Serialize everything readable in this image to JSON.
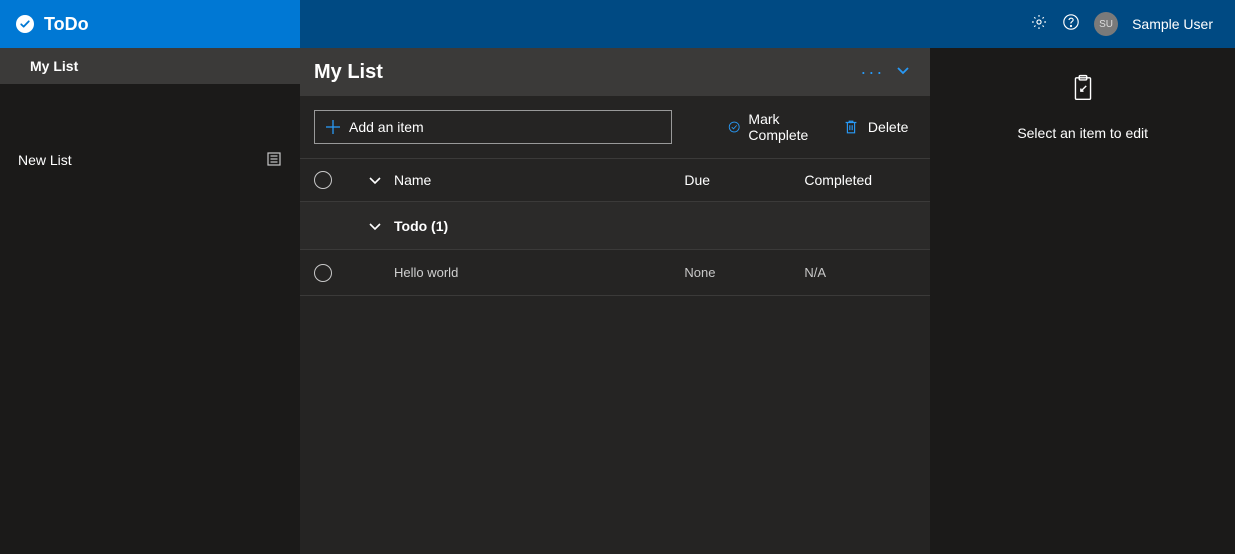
{
  "app": {
    "brand": "ToDo"
  },
  "header": {
    "user_name": "Sample User",
    "user_initials": "SU"
  },
  "sidebar": {
    "lists": [
      {
        "label": "My List",
        "active": true
      }
    ],
    "new_list_label": "New List"
  },
  "main": {
    "title": "My List",
    "add_item_label": "Add an item",
    "mark_complete_label": "Mark Complete",
    "delete_label": "Delete"
  },
  "table": {
    "columns": {
      "name": "Name",
      "due": "Due",
      "completed": "Completed"
    },
    "group_label": "Todo (1)",
    "rows": [
      {
        "name": "Hello world",
        "due": "None",
        "completed": "N/A"
      }
    ]
  },
  "right": {
    "empty_text": "Select an item to edit"
  }
}
